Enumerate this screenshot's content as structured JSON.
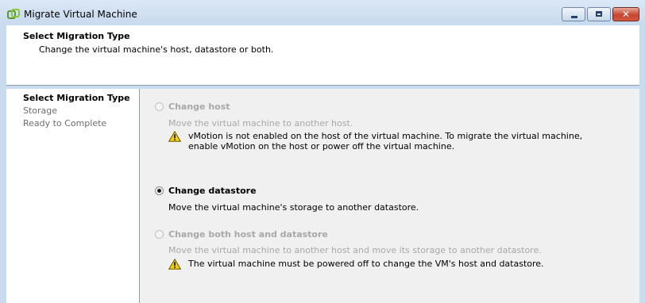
{
  "window": {
    "title": "Migrate Virtual Machine",
    "controls": {
      "close_glyph": "✕"
    }
  },
  "header": {
    "title": "Select Migration Type",
    "subtitle": "Change the virtual machine's host, datastore or both."
  },
  "steps": [
    {
      "label": "Select Migration Type",
      "active": true
    },
    {
      "label": "Storage",
      "active": false
    },
    {
      "label": "Ready to Complete",
      "active": false
    }
  ],
  "options": {
    "change_host": {
      "label": "Change host",
      "description": "Move the virtual machine to another host.",
      "enabled": false,
      "selected": false,
      "warning_line1": "vMotion is not enabled on the host of the virtual machine.  To migrate the virtual machine,",
      "warning_line2": "enable vMotion on the host or power off the virtual machine."
    },
    "change_datastore": {
      "label": "Change datastore",
      "description": "Move the virtual machine's storage to another datastore.",
      "enabled": true,
      "selected": true
    },
    "change_both": {
      "label": "Change both host and datastore",
      "description": "Move the virtual machine to another host and move its storage to another datastore.",
      "enabled": false,
      "selected": false,
      "warning": "The virtual machine must be powered off to change the VM's host and datastore."
    }
  },
  "icons": {
    "app": "vsphere-migrate-icon",
    "warning": "warning-icon"
  },
  "colors": {
    "disabled_text": "#a8a8a8",
    "warning_fill": "#f5d000",
    "close_button": "#c8452f"
  }
}
